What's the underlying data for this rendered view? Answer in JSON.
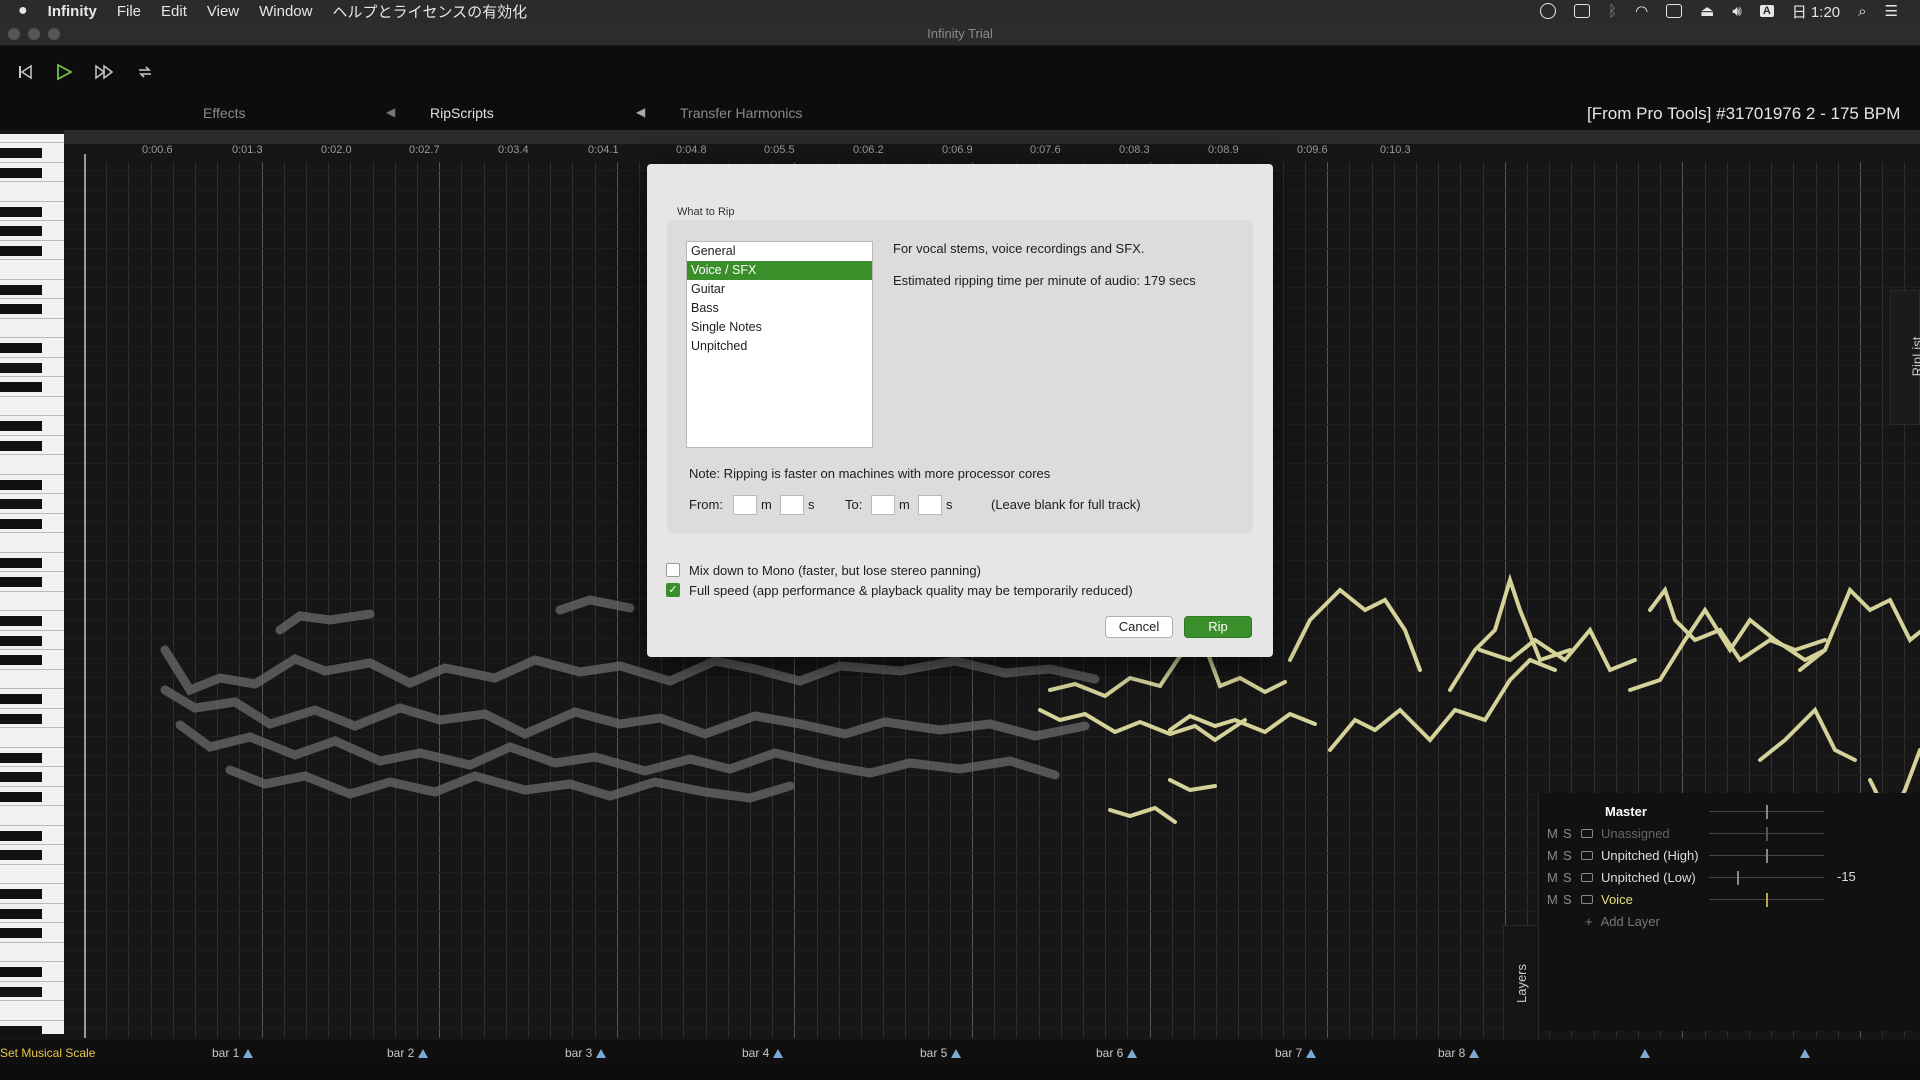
{
  "menubar": {
    "app": "Infinity",
    "items": [
      "File",
      "Edit",
      "View",
      "Window",
      "ヘルプとライセンスの有効化"
    ],
    "clock": "日 1:20",
    "input_indicator": "A"
  },
  "window": {
    "title": "Infinity Trial"
  },
  "toolbar": {
    "effects_label": "Effects",
    "ripscripts_label": "RipScripts",
    "transfer_label": "Transfer Harmonics",
    "track_title": "[From Pro Tools] #31701976 2 - 175 BPM"
  },
  "timeline": {
    "ticks": [
      "0:00.6",
      "0:01.3",
      "0:02.0",
      "0:02.7",
      "0:03.4",
      "0:04.1",
      "0:04.8",
      "0:05.5",
      "0:06.2",
      "0:06.9",
      "0:07.6",
      "0:08.3",
      "0:08.9",
      "0:09.6",
      "0:10.3"
    ]
  },
  "bars": {
    "scale_label": "Set Musical Scale",
    "items": [
      "bar 1",
      "bar 2",
      "bar 3",
      "bar 4",
      "bar 5",
      "bar 6",
      "bar 7",
      "bar 8",
      "",
      ""
    ]
  },
  "riplist_tab": "RipList",
  "layers": {
    "tab_label": "Layers",
    "master": "Master",
    "rows": [
      {
        "name": "Unassigned",
        "value": ""
      },
      {
        "name": "Unpitched (High)",
        "value": ""
      },
      {
        "name": "Unpitched (Low)",
        "value": "-15"
      },
      {
        "name": "Voice",
        "value": ""
      }
    ],
    "add_label": "Add Layer",
    "m": "M",
    "s": "S"
  },
  "dialog": {
    "section_title": "What to Rip",
    "options": [
      "General",
      "Voice / SFX",
      "Guitar",
      "Bass",
      "Single Notes",
      "Unpitched"
    ],
    "selected_option": "Voice / SFX",
    "description": "For vocal stems, voice recordings and SFX.",
    "estimate": "Estimated ripping time per minute of audio: 179 secs",
    "note": "Note: Ripping is faster on machines with more processor cores",
    "from_label": "From:",
    "to_label": "To:",
    "m_unit": "m",
    "s_unit": "s",
    "from_m": "",
    "from_s": "",
    "to_m": "",
    "to_s": "",
    "blank_hint": "(Leave blank for full track)",
    "mix_mono_label": "Mix down to Mono (faster, but lose stereo panning)",
    "mix_mono_checked": false,
    "full_speed_label": "Full speed (app performance & playback quality may be temporarily reduced)",
    "full_speed_checked": true,
    "cancel_label": "Cancel",
    "rip_label": "Rip"
  },
  "colors": {
    "accent_green": "#3a8f2b",
    "waveform_gray": "#6a6a6a",
    "waveform_yellow": "#e9e7a8",
    "scale_label": "#e8c84a",
    "voice_layer": "#e8df7a"
  }
}
